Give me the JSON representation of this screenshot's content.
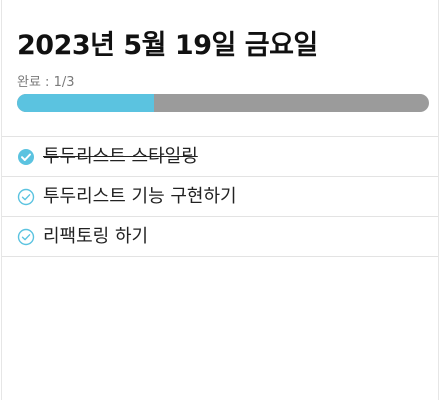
{
  "header": {
    "date_title": "2023년 5월 19일 금요일",
    "progress_text": "완료 : 1/3",
    "progress_fraction": 0.333
  },
  "colors": {
    "accent": "#5bc3e0",
    "track": "#9b9b9b"
  },
  "todos": [
    {
      "text": "투두리스트 스타일링",
      "done": true,
      "icon": "check-circle-filled-icon"
    },
    {
      "text": "투두리스트 기능 구현하기",
      "done": false,
      "icon": "check-circle-outline-icon"
    },
    {
      "text": "리팩토링 하기",
      "done": false,
      "icon": "check-circle-outline-icon"
    }
  ]
}
